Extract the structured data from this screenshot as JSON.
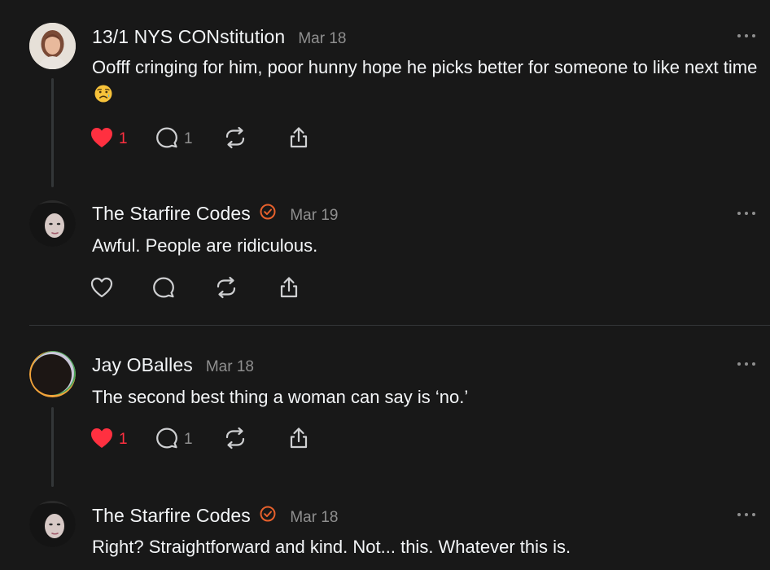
{
  "colors": {
    "background": "#181818",
    "text": "#f3f5f7",
    "muted": "#8f8f8f",
    "like": "#ff3040",
    "verified": "#e8612c"
  },
  "posts": [
    {
      "author": "13/1 NYS CONstitution",
      "date": "Mar 18",
      "text": "Oofff cringing for him, poor hunny hope he picks better for someone to like next time",
      "emoji": "sad-face-emoji",
      "verified": false,
      "liked": true,
      "likes": "1",
      "replies": "1"
    },
    {
      "author": "The Starfire Codes",
      "date": "Mar 19",
      "text": "Awful. People are ridiculous.",
      "verified": true,
      "liked": false
    },
    {
      "author": "Jay OBalles",
      "date": "Mar 18",
      "text": "The second best thing a woman can say is ‘no.’",
      "verified": false,
      "liked": true,
      "likes": "1",
      "replies": "1"
    },
    {
      "author": "The Starfire Codes",
      "date": "Mar 18",
      "text": "Right? Straightforward and kind. Not... this. Whatever this is.",
      "verified": true,
      "liked": false
    }
  ]
}
